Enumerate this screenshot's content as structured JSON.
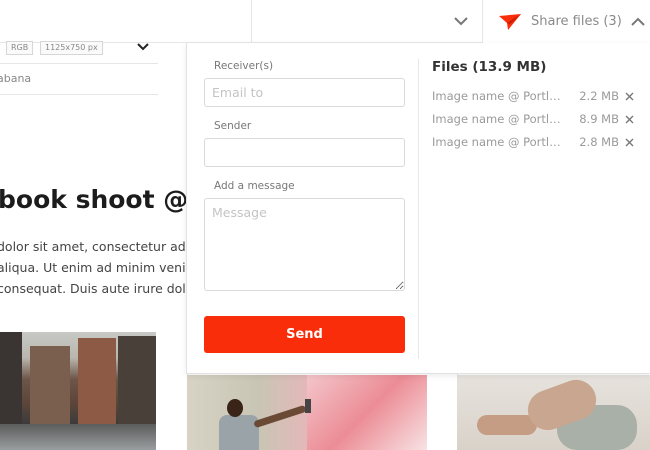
{
  "header": {
    "share_label": "Share files (3)"
  },
  "image_meta": {
    "color_mode": "RGB",
    "dimensions": "1125x750 px",
    "location": "abana"
  },
  "article": {
    "headline": "book shoot @ l",
    "body_lines": [
      "dolor sit amet, consectetur adip",
      "aliqua. Ut enim ad minim venia",
      "consequat. Duis aute irure dolo"
    ]
  },
  "share_form": {
    "receiver_label": "Receiver(s)",
    "receiver_placeholder": "Email to",
    "sender_label": "Sender",
    "sender_value": "",
    "message_label": "Add a message",
    "message_placeholder": "Message",
    "send_label": "Send"
  },
  "files": {
    "title": "Files (13.9 MB)",
    "items": [
      {
        "name": "Image name @ Portland",
        "size": "2.2 MB"
      },
      {
        "name": "Image name @ Portland",
        "size": "8.9 MB"
      },
      {
        "name": "Image name @ Portland",
        "size": "2.8 MB"
      }
    ]
  },
  "colors": {
    "accent": "#fa2d0a",
    "border": "#e6e6e6",
    "muted_text": "#9a9a9a"
  },
  "icons": {
    "share": "paper-plane-icon",
    "collapse": "chevron-up-icon",
    "expand": "chevron-down-icon",
    "remove": "close-icon"
  }
}
